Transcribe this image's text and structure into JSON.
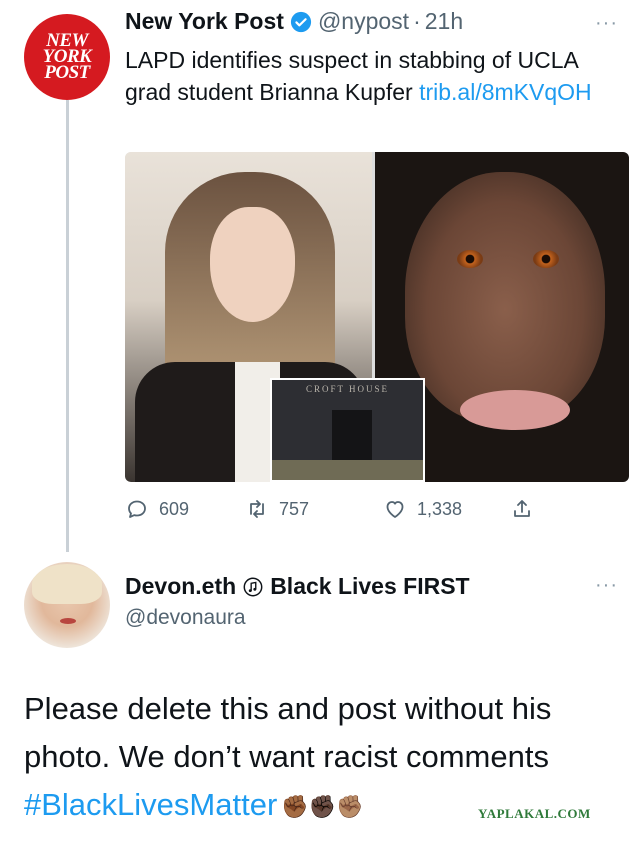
{
  "tweet1": {
    "avatar_logo": "NEW YORK POST",
    "name": "New York Post",
    "handle": "@nypost",
    "separator": "·",
    "time": "21h",
    "more": "···",
    "text": "LAPD identifies suspect in stabbing of UCLA grad student Brianna Kupfer ",
    "link": "trib.al/8mKVqOH",
    "media": {
      "inset_sign": "CROFT HOUSE"
    },
    "stats": {
      "replies": "609",
      "retweets": "757",
      "likes": "1,338"
    }
  },
  "tweet2": {
    "name": "Devon.eth",
    "name_suffix": "Black Lives FIRST",
    "handle": "@devonaura",
    "more": "···",
    "text": "Please delete this and post without his photo. We don’t want racist comments ",
    "hashtag": "#BlackLivesMatter",
    "emoji": "✊🏾✊🏿✊🏽"
  },
  "watermark": "YAPLAKAL.COM",
  "colors": {
    "link": "#1d9bf0",
    "nyp_red": "#d51a20",
    "secondary_text": "#536471"
  }
}
